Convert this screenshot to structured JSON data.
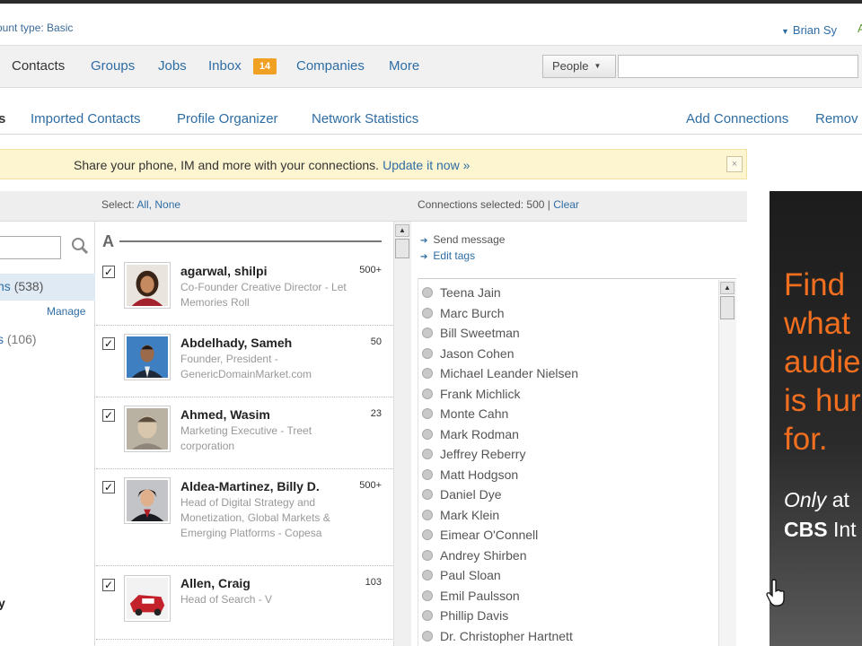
{
  "account": {
    "type_label": "ount type: Basic",
    "user_name": "Brian Sy"
  },
  "nav": {
    "contacts": "Contacts",
    "groups": "Groups",
    "jobs": "Jobs",
    "inbox": "Inbox",
    "inbox_count": "14",
    "companies": "Companies",
    "more": "More"
  },
  "search": {
    "scope": "People",
    "query": ""
  },
  "subnav": {
    "first_tab_fragment": "s",
    "imported": "Imported Contacts",
    "organizer": "Profile Organizer",
    "stats": "Network Statistics",
    "add": "Add Connections",
    "remove": "Remov"
  },
  "notice": {
    "text": "Share your phone, IM and more with your connections.",
    "link": "Update it now »",
    "close": "×"
  },
  "header": {
    "select_prefix": "Select:",
    "select_all": "All,",
    "select_none": "None",
    "selected_text": "Connections selected: 500 |",
    "clear": "Clear"
  },
  "tags": {
    "all_name": "ns",
    "all_count": "(538)",
    "manage": "Manage",
    "second_name": "s",
    "second_count": "(106)",
    "bottom_fragment": "y"
  },
  "list": {
    "letter": "A",
    "contacts": [
      {
        "name": "agarwal, shilpi",
        "title": "Co-Founder Creative Director - Let Memories Roll",
        "count": "500+"
      },
      {
        "name": "Abdelhady, Sameh",
        "title": "Founder, President - GenericDomainMarket.com",
        "count": "50"
      },
      {
        "name": "Ahmed, Wasim",
        "title": "Marketing Executive - Treet corporation",
        "count": "23"
      },
      {
        "name": "Aldea-Martinez, Billy D.",
        "title": "Head of Digital Strategy and Monetization, Global Markets & Emerging Platforms - Copesa",
        "count": "500+"
      },
      {
        "name": "Allen, Craig",
        "title": "Head of Search - V",
        "count": "103"
      }
    ]
  },
  "actions": {
    "send": "Send message",
    "edit": "Edit tags"
  },
  "selected": [
    "Teena Jain",
    "Marc Burch",
    "Bill Sweetman",
    "Jason Cohen",
    "Michael Leander Nielsen",
    "Frank Michlick",
    "Monte Cahn",
    "Mark Rodman",
    "Jeffrey Reberry",
    "Matt Hodgson",
    "Daniel Dye",
    "Mark Klein",
    "Eimear O'Connell",
    "Andrey Shirben",
    "Paul Sloan",
    "Emil Paulsson",
    "Phillip Davis",
    "Dr. Christopher Hartnett"
  ],
  "ad": {
    "line1": "Find",
    "line2": "what",
    "line3": "audie",
    "line4": "is hur",
    "line5": "for.",
    "only": "Only",
    "at": "at",
    "cbs": "CBS",
    "cbs_rest": "Int"
  },
  "colors": {
    "link": "#2e6da4",
    "badge": "#f0a023",
    "notice_bg": "#fcf5d0",
    "ad_orange": "#f36f20"
  }
}
